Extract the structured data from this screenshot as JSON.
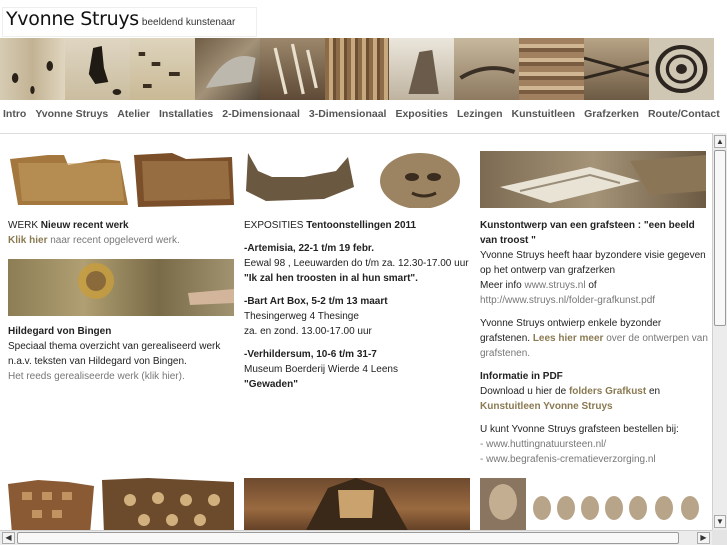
{
  "header": {
    "name": "Yvonne Struys",
    "subtitle": "beeldend kunstenaar"
  },
  "nav": [
    "Intro",
    "Yvonne Struys",
    "Atelier",
    "Installaties",
    "2-Dimensionaal",
    "3-Dimensionaal",
    "Exposities",
    "Lezingen",
    "Kunstuitleen",
    "Grafzerken",
    "Route/Contact"
  ],
  "col1": {
    "werk_prefix": "WERK ",
    "werk_title": "Nieuw recent werk",
    "klik_hier": "Klik hier",
    "klik_rest": " naar recent opgeleverd werk.",
    "hildegard_title": "Hildegard von Bingen",
    "hildegard_line1": "Speciaal thema overzicht van gerealiseerd werk",
    "hildegard_line2": "n.a.v. teksten van Hildegard von Bingen.",
    "hildegard_link": "Het reeds gerealiseerde werk (klik hier)."
  },
  "col2": {
    "expo_prefix": "EXPOSITIES ",
    "expo_title": "Tentoonstellingen 2011",
    "e1_title": "-Artemisia, 22-1 t/m 19 febr.",
    "e1_line": "Eewal 98 , Leeuwarden do t/m za. 12.30-17.00 uur",
    "e1_quote": "\"Ik zal hen troosten in al hun smart\".",
    "e2_title": "-Bart Art Box, 5-2 t/m 13 maart",
    "e2_line1": "Thesingerweg 4 Thesinge",
    "e2_line2": "za. en zond. 13.00-17.00 uur",
    "e3_title": "-Verhildersum,  10-6 t/m 31-7",
    "e3_line": "Museum Boerderij Wierde 4 Leens",
    "e3_quote": "\"Gewaden\""
  },
  "col3": {
    "k_title1": "Kunstontwerp van een grafsteen : \"een beeld",
    "k_title2": "van troost \"",
    "k_line1": "Yvonne Struys heeft haar byzondere visie gegeven",
    "k_line2": "op het ontwerp van grafzerken",
    "k_meer_prefix": "Meer info ",
    "k_meer_link": "www.struys.nl",
    "k_meer_suffix": " of",
    "k_url": "http://www.struys.nl/folder-grafkunst.pdf",
    "o_line1": "Yvonne Struys ontwierp enkele byzonder",
    "o_line2_prefix": "grafstenen. ",
    "o_line2_link": "Lees hier meer",
    "o_line2_suffix": " over de ontwerpen van",
    "o_line3": "grafstenen.",
    "pdf_title": "Informatie in PDF",
    "pdf_prefix": "Download u hier de ",
    "pdf_link1": "folders Grafkust",
    "pdf_mid": " en",
    "pdf_link2": "Kunstuitleen Yvonne Struys",
    "order_line": "U kunt Yvonne Struys grafsteen bestellen bij:",
    "order_link1": "- www.huttingnatuursteen.nl/",
    "order_link2": "- www.begrafenis-crematieverzorging.nl"
  },
  "colors": {
    "link_accent": "#8a7a52",
    "nav_text": "#555555",
    "scrollbar": "#ececec"
  }
}
